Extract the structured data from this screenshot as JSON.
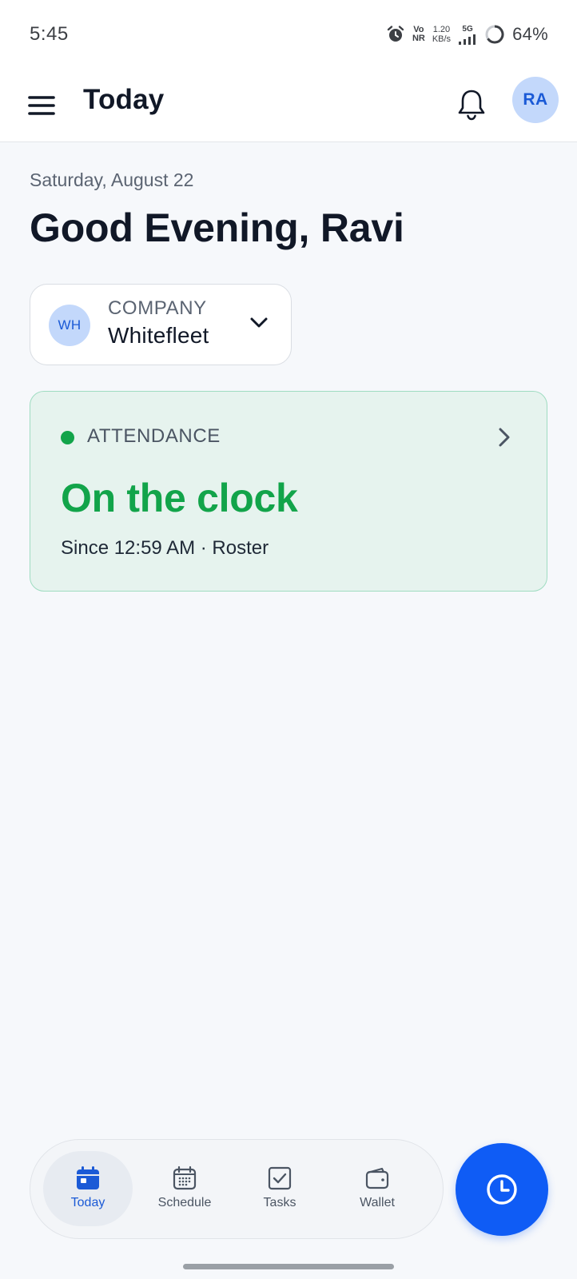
{
  "status_bar": {
    "time": "5:45",
    "volte_top": "Vo",
    "volte_bottom": "NR",
    "speed_value": "1.20",
    "speed_unit": "KB/s",
    "network": "5G",
    "battery": "64%",
    "icons": [
      "alarm-icon",
      "signal-icon",
      "battery-ring-icon"
    ]
  },
  "app_bar": {
    "title": "Today",
    "avatar_initials": "RA",
    "icons": [
      "menu-icon",
      "bell-icon"
    ]
  },
  "greeting": {
    "date": "Saturday, August 22",
    "text": "Good Evening, Ravi"
  },
  "company": {
    "badge": "WH",
    "label": "COMPANY",
    "name": "Whitefleet",
    "icon": "chevron-down-icon"
  },
  "attendance": {
    "label": "ATTENDANCE",
    "status": "On the clock",
    "since": "Since 12:59 AM · Roster",
    "status_color": "#12a44a",
    "icon": "chevron-right-icon"
  },
  "bottom_nav": {
    "active": "Today",
    "items": [
      {
        "label": "Today",
        "icon": "calendar-today-icon"
      },
      {
        "label": "Schedule",
        "icon": "calendar-grid-icon"
      },
      {
        "label": "Tasks",
        "icon": "checkbox-icon"
      },
      {
        "label": "Wallet",
        "icon": "wallet-icon"
      }
    ]
  },
  "fab": {
    "icon": "clock-icon"
  },
  "colors": {
    "accent": "#0f5cf5",
    "success": "#12a44a",
    "card_background": "#e6f3ee",
    "badge_background": "#c3d8fb"
  }
}
